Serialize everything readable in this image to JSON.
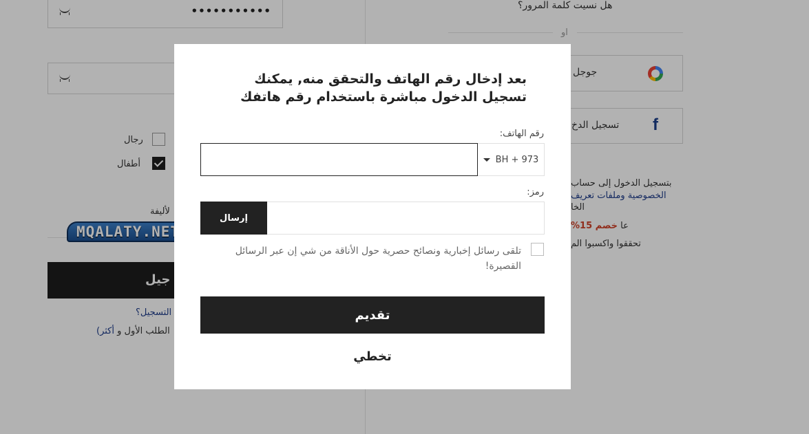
{
  "background": {
    "password_mask": "•••••••••••",
    "forgot_password": "هل نسيت كلمة المرور؟",
    "or_label": "او",
    "google_label": "جوجل",
    "facebook_label": "تسجيل الدخ",
    "gender_men": "رجال",
    "gender_kids": "أطفال",
    "elegance_fragment": "لأليفة",
    "register_btn": "جيل",
    "register_question": "التسجيل؟",
    "first_order_text": "الطلب الأول و",
    "first_order_link": "أكثر)",
    "login_info_1": "بتسجيل الدخول إلى حساب",
    "login_info_2": "الخصوصية وملفات تعريف",
    "login_info_3": "الخا",
    "discount": "خصم 15%",
    "discount_tail": "عا",
    "explore": "تحققوا واكسبوا الم",
    "watermark": "MQALATY.NET"
  },
  "modal": {
    "title": "بعد إدخال رقم الهاتف والتحقق منه, يمكنك تسجيل الدخول مباشرة باستخدام رقم هاتفك",
    "phone_label": "رقم الهاتف:",
    "country_code": "BH + 973",
    "phone_value": "",
    "code_label": "رمز:",
    "code_value": "",
    "send_btn": "إرسال",
    "newsletter_label": "تلقى رسائل إخبارية ونصائح حصرية حول الأناقة من شي إن عبر الرسائل القصيرة!",
    "newsletter_checked": false,
    "submit_btn": "تقديم",
    "skip_btn": "تخطي"
  },
  "colors": {
    "dark_button": "#222222",
    "link": "#1d3b8a",
    "discount_red": "#d0432a",
    "overlay": "rgba(0,0,0,0.30)"
  }
}
